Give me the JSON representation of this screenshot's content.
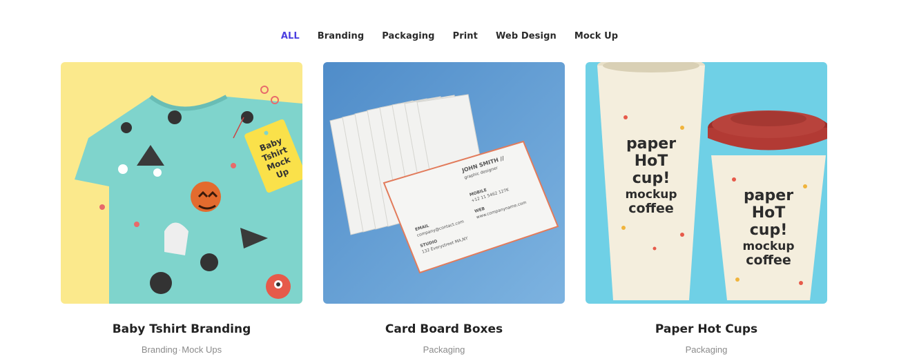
{
  "filters": [
    {
      "label": "ALL",
      "active": true
    },
    {
      "label": "Branding",
      "active": false
    },
    {
      "label": "Packaging",
      "active": false
    },
    {
      "label": "Print",
      "active": false
    },
    {
      "label": "Web Design",
      "active": false
    },
    {
      "label": "Mock Up",
      "active": false
    }
  ],
  "cards": [
    {
      "title": "Baby Tshirt Branding",
      "tags": [
        "Branding",
        "Mock Ups"
      ],
      "tag_separator": "·",
      "tshirt_tag_lines": [
        "Baby",
        "Tshirt",
        "Mock",
        "Up"
      ]
    },
    {
      "title": "Card Board Boxes",
      "tags": [
        "Packaging"
      ],
      "business_card": {
        "name": "JOHN SMITH //",
        "role": "graphic designer",
        "mobile_label": "MOBILE",
        "mobile": "+12 11 5462 127K",
        "web_label": "WEB",
        "web": "www.companyname.com",
        "email_label": "EMAIL",
        "email": "company@contact.com",
        "studio_label": "STUDIO",
        "studio": "132 Everystreet MA,NY"
      }
    },
    {
      "title": "Paper Hot Cups",
      "tags": [
        "Packaging"
      ],
      "cup_lines": [
        "paper",
        "HoT",
        "cup!",
        "mockup",
        "coffee"
      ]
    }
  ],
  "colors": {
    "accent": "#4b3fe0",
    "tshirt_bg": "#fbe98c",
    "tshirt": "#7fd4cc",
    "cards_bg": "#6a9fd3",
    "cups_bg": "#6fd0e6",
    "cup_lid": "#b23a34"
  }
}
